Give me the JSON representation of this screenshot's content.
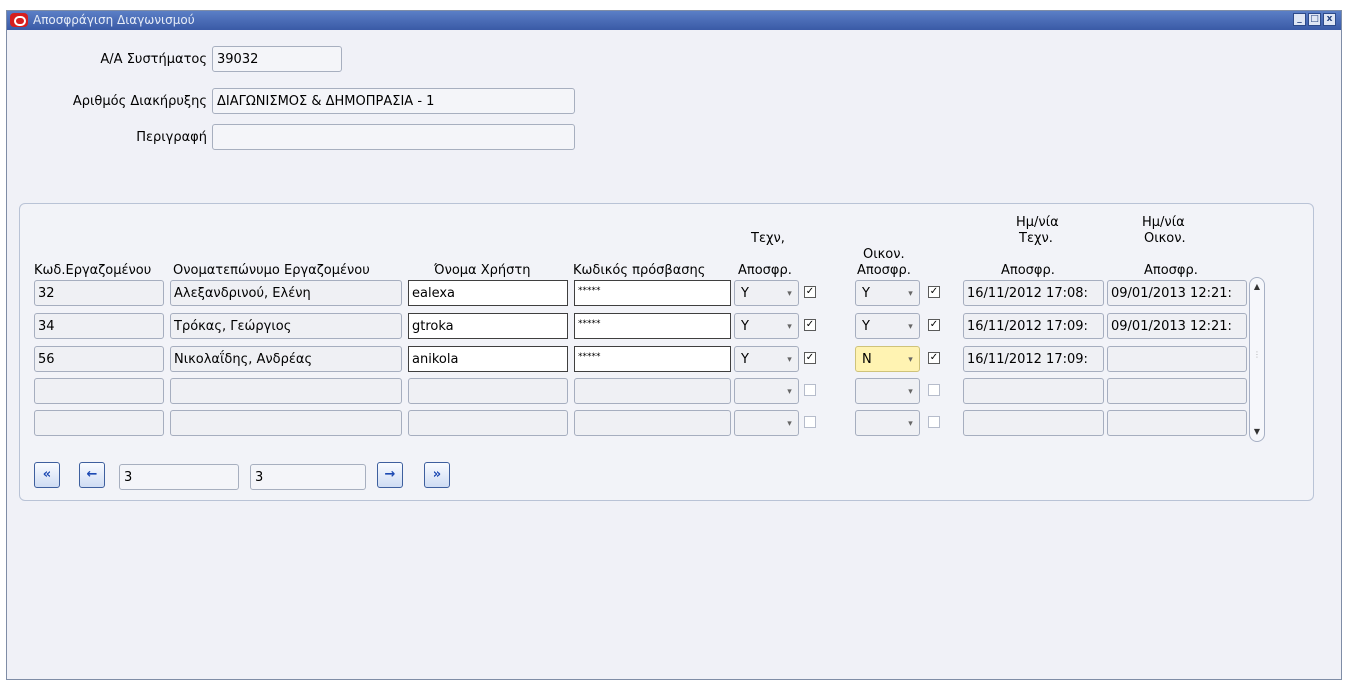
{
  "window": {
    "title": "Αποσφράγιση Διαγωνισμού",
    "controls": {
      "minimize": "_",
      "restore": "□",
      "close": "x"
    }
  },
  "header": {
    "system_id_label": "Α/Α Συστήματος",
    "system_id_value": "39032",
    "announcement_label": "Αριθμός Διακήρυξης",
    "announcement_value": "ΔΙΑΓΩΝΙΣΜΟΣ & ΔΗΜΟΠΡΑΣΙΑ - 1",
    "description_label": "Περιγραφή",
    "description_value": ""
  },
  "table": {
    "headers": {
      "emp_code": "Κωδ.Εργαζομένου",
      "emp_name": "Ονοματεπώνυμο Εργαζομένου",
      "username": "Όνομα Χρήστη",
      "password": "Κωδικός πρόσβασης",
      "tech_l1": "Τεχν,",
      "tech_l2": "Αποσφρ.",
      "econ_l1": "Οικον.",
      "econ_l2": "Αποσφρ.",
      "tdate_l1": "Ημ/νία",
      "tdate_l2": "Τεχν.",
      "tdate_l3": "Αποσφρ.",
      "edate_l1": "Ημ/νία",
      "edate_l2": "Οικον.",
      "edate_l3": "Αποσφρ."
    },
    "rows": [
      {
        "code": "32",
        "name": "Αλεξανδρινού, Ελένη",
        "username": "ealexa",
        "password": "*****",
        "tech": "Y",
        "tech_checked": true,
        "econ": "Y",
        "econ_checked": true,
        "tech_date": "16/11/2012 17:08:",
        "econ_date": "09/01/2013 12:21:"
      },
      {
        "code": "34",
        "name": "Τρόκας, Γεώργιος",
        "username": "gtroka",
        "password": "*****",
        "tech": "Y",
        "tech_checked": true,
        "econ": "Y",
        "econ_checked": true,
        "tech_date": "16/11/2012 17:09:",
        "econ_date": "09/01/2013 12:21:"
      },
      {
        "code": "56",
        "name": "Νικολαΐδης, Ανδρέας",
        "username": "anikola",
        "password": "*****",
        "tech": "Y",
        "tech_checked": true,
        "econ": "N",
        "econ_checked": true,
        "tech_date": "16/11/2012 17:09:",
        "econ_date": ""
      },
      {
        "code": "",
        "name": "",
        "username": "",
        "password": "",
        "tech": "",
        "tech_checked": false,
        "econ": "",
        "econ_checked": false,
        "tech_date": "",
        "econ_date": ""
      },
      {
        "code": "",
        "name": "",
        "username": "",
        "password": "",
        "tech": "",
        "tech_checked": false,
        "econ": "",
        "econ_checked": false,
        "tech_date": "",
        "econ_date": ""
      }
    ]
  },
  "navigation": {
    "first": "«",
    "prev": "←",
    "next": "→",
    "last": "»",
    "current_record": "3",
    "total_records": "3"
  },
  "colors": {
    "titlebar": "#3a5aa6",
    "highlight_field": "#fff3b2",
    "nav_icon": "#1d4ab3"
  }
}
